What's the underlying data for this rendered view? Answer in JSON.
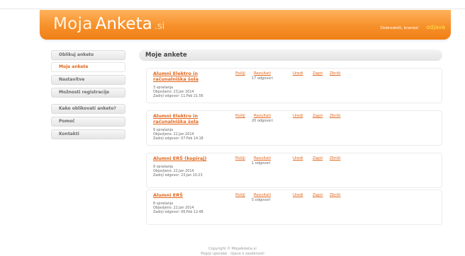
{
  "header": {
    "logo_moja": "Moja",
    "logo_anketa": "Anketa",
    "logo_si": ".si",
    "greeting": "Dobrodošli, branka!",
    "logout": "odjava",
    "accent": "#f7902a"
  },
  "sidebar": {
    "items": [
      {
        "label": "Oblikuj anketo"
      },
      {
        "label": "Moje ankete",
        "active": true
      },
      {
        "label": "Nastavitve"
      },
      {
        "label": "Možnosti registracije"
      },
      {
        "label": "Kako oblikovati anketo?"
      },
      {
        "label": "Pomoč"
      },
      {
        "label": "Kontakti"
      }
    ]
  },
  "main": {
    "title": "Moje ankete",
    "surveys": [
      {
        "title": "Alumni Elektro in računalniška šola",
        "questions": "3 vprašanja",
        "published": "Objavljeno: 23.Jan 2014",
        "last_answer": "Zadnji odgovor: 11.Feb 21:56",
        "count": "17 odgovori"
      },
      {
        "title": "Alumni Elektro in računalniška šola",
        "questions": "9 vprašanja",
        "published": "Objavljeno: 22.Jan 2014",
        "last_answer": "Zadnji odgovor: 07.Feb 14:18",
        "count": "20 odgovori"
      },
      {
        "title": "Alumni ERŠ (kopiraj)",
        "questions": "9 vprašanja",
        "published": "Objavljeno: 22.Jan 2014",
        "last_answer": "Zadnji odgovor: 23.Jan 10:23",
        "count": "1 odgovori"
      },
      {
        "title": "Alumni ERŠ",
        "questions": "8 vprašanja",
        "published": "Objavljeno: 22.Jan 2014",
        "last_answer": "Zadnji odgovor: 06.Feb 12:48",
        "count": "5 odgovori"
      }
    ],
    "actions": {
      "send": "Pošlji",
      "results": "Rezultati",
      "edit": "Uredi",
      "close": "Zapri",
      "delete": "Zbriši"
    }
  },
  "footer": {
    "copyright": "Copyright © MojaAnketa.si",
    "links": "Pogoji uporabe · Izjava o zasebnosti"
  }
}
